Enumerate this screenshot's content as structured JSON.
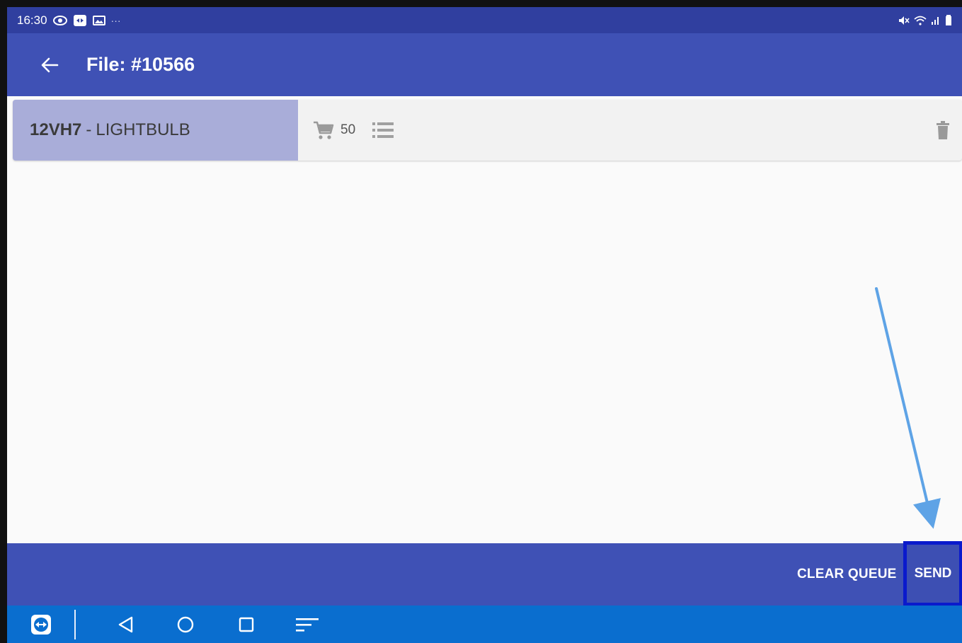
{
  "status_bar": {
    "time": "16:30",
    "more": "···"
  },
  "app_bar": {
    "title": "File: #10566"
  },
  "queue": {
    "items": [
      {
        "code": "12VH7",
        "separator": "-",
        "name": "LIGHTBULB",
        "quantity": "50"
      }
    ]
  },
  "actions": {
    "clear_label": "CLEAR QUEUE",
    "send_label": "SEND"
  },
  "colors": {
    "status_bar": "#303f9f",
    "app_bar": "#3f51b5",
    "row_highlight": "#a9add9",
    "nav_bar": "#0a6ecf",
    "send_outline": "#0a1acc",
    "annotation_arrow": "#5ea3e6"
  },
  "icons": {
    "back": "arrow-left-icon",
    "cart": "shopping-cart-icon",
    "list": "list-icon",
    "delete": "trash-icon",
    "nav": [
      "teamviewer-icon",
      "back-triangle-icon",
      "home-circle-icon",
      "recents-square-icon",
      "menu-lines-icon"
    ]
  }
}
